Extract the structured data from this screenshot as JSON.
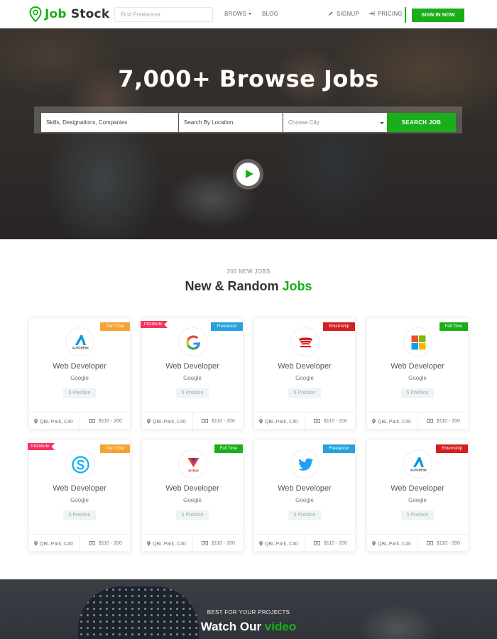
{
  "brand": {
    "name_part1": "Job",
    "name_part2": "Stock"
  },
  "nav": {
    "search_placeholder": "Find Freelancer",
    "browse": "BROWS",
    "blog": "BLOG",
    "signup": "SIGNUP",
    "pricing": "PRICING",
    "signin": "SIGN IN NOW"
  },
  "hero": {
    "title": "7,000+ Browse Jobs",
    "skills_placeholder": "Skills, Designations, Companies",
    "location_placeholder": "Search By Location",
    "city_select": "Choose City",
    "search_button": "SEARCH JOB"
  },
  "jobs_section": {
    "subtitle": "200 NEW JOBS",
    "title_part1": "New & Random",
    "title_part2": "Jobs"
  },
  "jobs": [
    {
      "badge": "Part Time",
      "premium": "",
      "logo": "autodesk-logo",
      "title": "Web Developer",
      "company": "Google",
      "positions": "5 Position",
      "location": "QBL Park, C40",
      "salary": "$110 - 200"
    },
    {
      "badge": "Freelancer",
      "premium": "PREMIUM",
      "logo": "google-logo",
      "title": "Web Developer",
      "company": "Google",
      "positions": "5 Position",
      "location": "QBL Park, C40",
      "salary": "$110 - 200"
    },
    {
      "badge": "Enternship",
      "premium": "",
      "logo": "honda-logo",
      "title": "Web Developer",
      "company": "Google",
      "positions": "5 Position",
      "location": "QBL Park, C40",
      "salary": "$110 - 200"
    },
    {
      "badge": "Full Time",
      "premium": "",
      "logo": "microsoft-logo",
      "title": "Web Developer",
      "company": "Google",
      "positions": "5 Position",
      "location": "QBL Park, C40",
      "salary": "$110 - 200"
    },
    {
      "badge": "Part Time",
      "premium": "PREMIUM",
      "logo": "skype-logo",
      "title": "Web Developer",
      "company": "Google",
      "positions": "5 Position",
      "location": "QBL Park, C40",
      "salary": "$110 - 200"
    },
    {
      "badge": "Full Time",
      "premium": "",
      "logo": "virtue-logo",
      "title": "Web Developer",
      "company": "Google",
      "positions": "5 Position",
      "location": "QBL Park, C40",
      "salary": "$110 - 200"
    },
    {
      "badge": "Freelancer",
      "premium": "",
      "logo": "twitter-logo",
      "title": "Web Developer",
      "company": "Google",
      "positions": "5 Position",
      "location": "QBL Park, C40",
      "salary": "$110 - 200"
    },
    {
      "badge": "Enternship",
      "premium": "",
      "logo": "autodesk-logo",
      "title": "Web Developer",
      "company": "Google",
      "positions": "5 Position",
      "location": "QBL Park, C40",
      "salary": "$110 - 200"
    }
  ],
  "logo_text": {
    "autodesk": "AUTODESK",
    "virtue": "virtue"
  },
  "video_section": {
    "subtitle": "BEST FOR YOUR PROJECTS",
    "title_part1": "Watch Our",
    "title_part2": "video"
  },
  "colors": {
    "accent": "#1aaf1a",
    "part_time": "#f7a233",
    "freelancer": "#28a0de",
    "internship": "#d21f1f",
    "full_time": "#1aaf1a",
    "premium": "#f5345e"
  }
}
